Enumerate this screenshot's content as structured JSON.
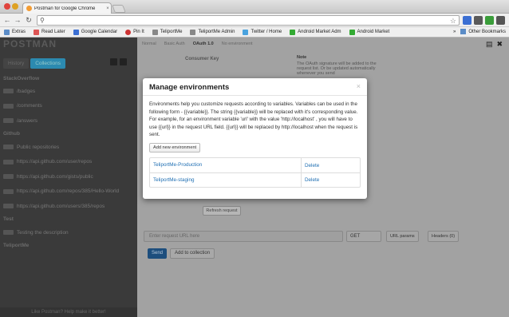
{
  "window": {
    "tab_title": "Postman for Google Chrome",
    "tab_close": "×"
  },
  "toolbar": {
    "back": "←",
    "forward": "→",
    "reload": "↻",
    "url_value": "",
    "search_glyph": "⚲",
    "star": "☆"
  },
  "bookmarks": {
    "items": [
      {
        "label": "Extras",
        "icon": "folder-icon",
        "color": "#5b8cc7"
      },
      {
        "label": "Read Later",
        "icon": "bookmark-icon",
        "color": "#d55"
      },
      {
        "label": "Google Calendar",
        "icon": "calendar-icon",
        "color": "#3b6fd3"
      },
      {
        "label": "Pin It",
        "icon": "pin-icon",
        "color": "#c33"
      },
      {
        "label": "TeliportMe",
        "icon": "globe-icon",
        "color": "#888"
      },
      {
        "label": "TeliportMe Admin",
        "icon": "globe-icon",
        "color": "#888"
      },
      {
        "label": "Twitter / Home",
        "icon": "twitter-icon",
        "color": "#4aa3df"
      },
      {
        "label": "Android Market Adm",
        "icon": "android-icon",
        "color": "#3a3"
      },
      {
        "label": "Android Market",
        "icon": "android-icon",
        "color": "#3a3"
      }
    ],
    "overflow": "»",
    "other": "Other Bookmarks"
  },
  "sidebar": {
    "logo": "POSTMAN",
    "tabs": [
      {
        "label": "History",
        "active": false
      },
      {
        "label": "Collections",
        "active": true
      }
    ],
    "items": [
      {
        "type": "header",
        "label": "StackOverflow"
      },
      {
        "type": "request",
        "label": "/badges"
      },
      {
        "type": "request",
        "label": "/comments"
      },
      {
        "type": "request",
        "label": "/answers"
      },
      {
        "type": "header",
        "label": "Github"
      },
      {
        "type": "request",
        "label": "Public repositories"
      },
      {
        "type": "request",
        "label": "https://api.github.com/user/repos"
      },
      {
        "type": "request",
        "label": "https://api.github.com/gists/public"
      },
      {
        "type": "request",
        "label": "https://api.github.com/repos/385/Hello-World"
      },
      {
        "type": "request",
        "label": "https://api.github.com/users/385/repos"
      },
      {
        "type": "header",
        "label": "Test"
      },
      {
        "type": "request",
        "label": "Testing the description"
      },
      {
        "type": "header",
        "label": "TeliportMe"
      }
    ],
    "footer": "Like Postman? Help make it better!"
  },
  "main": {
    "tabs": [
      "Normal",
      "Basic Auth",
      "OAuth 1.0",
      "No environment"
    ],
    "consumer_key_label": "Consumer Key",
    "note_title": "Note",
    "note_text": "The OAuth signature will be added to the request list. Or be updated automatically whenever you send",
    "refresh_label": "Refresh request",
    "url_placeholder": "Enter request URL here",
    "method": "GET",
    "url_params_label": "URL params",
    "headers_label": "Headers (0)",
    "send_label": "Send",
    "add_collection_label": "Add to collection"
  },
  "modal": {
    "title": "Manage environments",
    "close": "×",
    "description": "Environments help you customize requests according to variables. Variables can be used in the following form - {{variable}}. The string {{variable}} will be replaced with it's corresponding value. For example, for an environment variable 'url' with the value 'http://localhost' , you will have to use {{url}} in the request URL field. {{url}} will be replaced by http://localhost when the request is sent.",
    "add_button": "Add new environment",
    "environments": [
      {
        "name": "TeliportMe-Production",
        "action": "Delete"
      },
      {
        "name": "TeliportMe-staging",
        "action": "Delete"
      }
    ]
  }
}
